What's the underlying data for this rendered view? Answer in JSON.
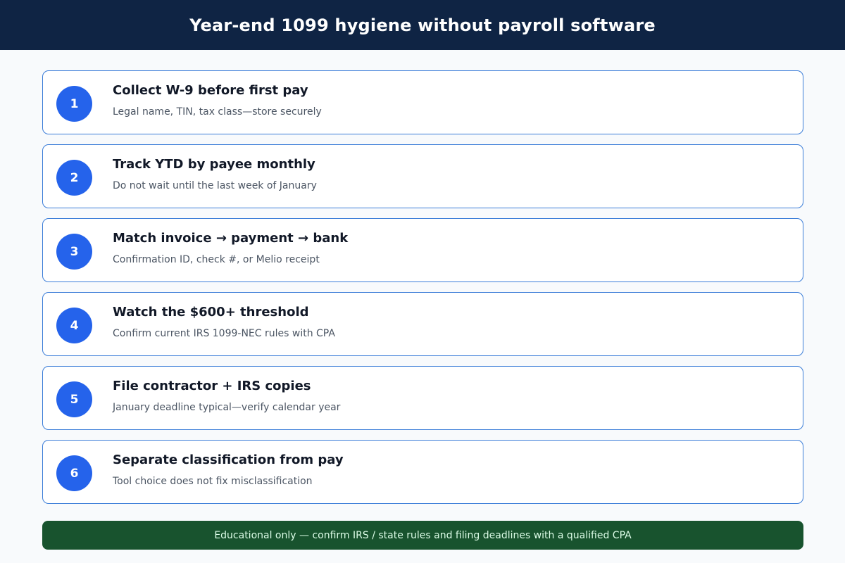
{
  "title": "Year-end 1099 hygiene without payroll software",
  "steps": [
    {
      "number": "1",
      "title": "Collect W-9 before first pay",
      "description": "Legal name, TIN, tax class—store securely"
    },
    {
      "number": "2",
      "title": "Track YTD by payee monthly",
      "description": "Do not wait until the last week of January"
    },
    {
      "number": "3",
      "title": "Match invoice → payment → bank",
      "description": "Confirmation ID, check #, or Melio receipt"
    },
    {
      "number": "4",
      "title": "Watch the $600+ threshold",
      "description": "Confirm current IRS 1099-NEC rules with CPA"
    },
    {
      "number": "5",
      "title": "File contractor + IRS copies",
      "description": "January deadline typical—verify calendar year"
    },
    {
      "number": "6",
      "title": "Separate classification from pay",
      "description": "Tool choice does not fix misclassification"
    }
  ],
  "footer": {
    "text": "Educational only — confirm IRS / state rules and filing deadlines with a qualified CPA"
  },
  "colors": {
    "header_bg": "#0f2444",
    "accent": "#2563eb",
    "card_border": "#3b7dd8",
    "footer_bg": "#18532e"
  }
}
